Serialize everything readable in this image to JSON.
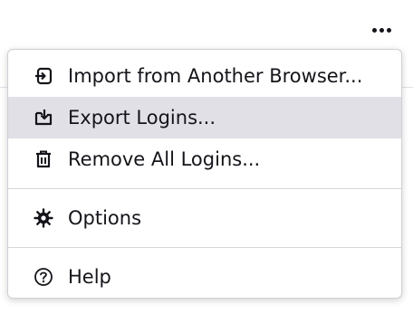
{
  "app": {
    "more_menu_icon": "more-horizontal-icon"
  },
  "menu": {
    "items": [
      {
        "label": "Import from Another Browser...",
        "icon": "import-icon",
        "highlighted": false
      },
      {
        "label": "Export Logins...",
        "icon": "export-icon",
        "highlighted": true
      },
      {
        "label": "Remove All Logins...",
        "icon": "trash-icon",
        "highlighted": false
      },
      {
        "label": "Options",
        "icon": "gear-icon",
        "highlighted": false
      },
      {
        "label": "Help",
        "icon": "help-icon",
        "highlighted": false
      }
    ]
  },
  "colors": {
    "highlight": "#e0e0e6",
    "text": "#15141a",
    "border": "#cfcfd8"
  }
}
